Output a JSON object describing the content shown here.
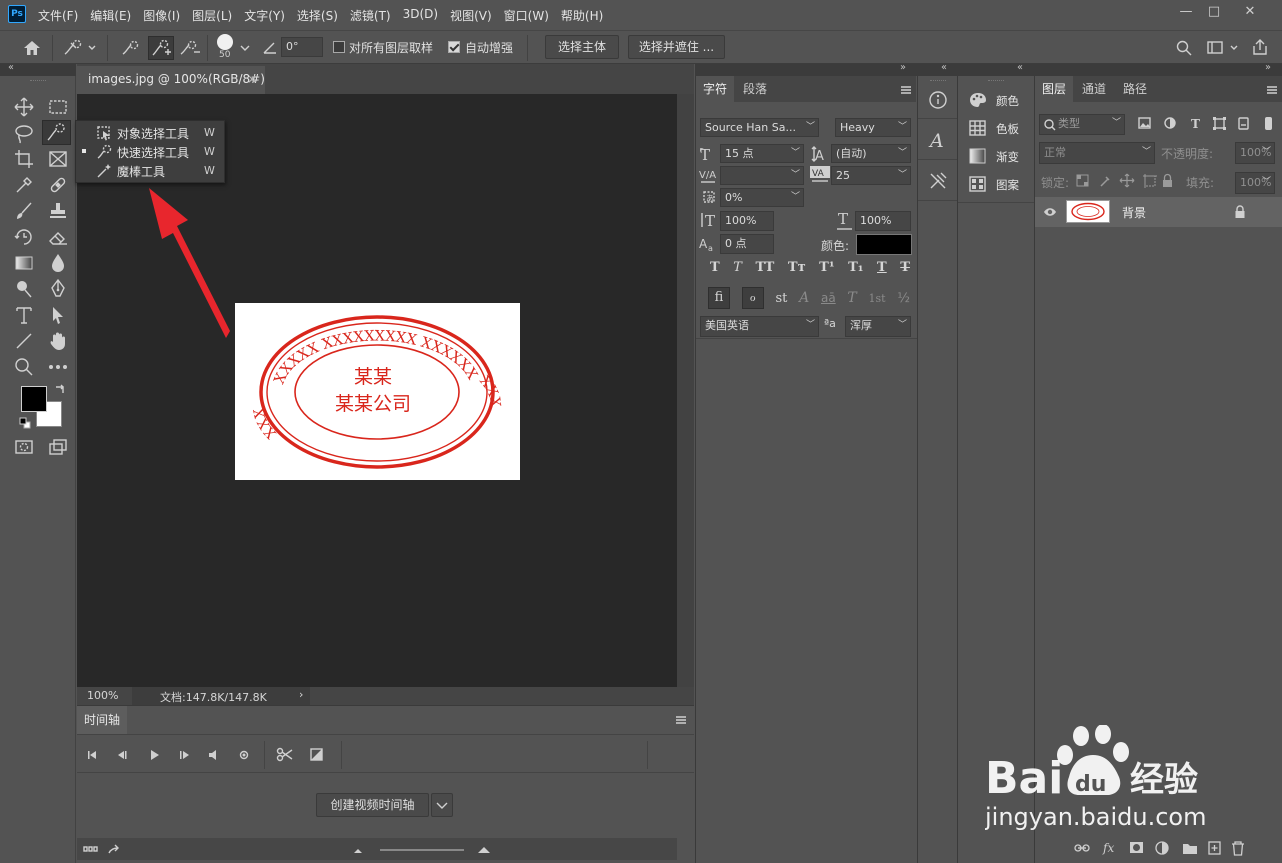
{
  "app": {
    "logo": "Ps"
  },
  "menu": [
    "文件(F)",
    "编辑(E)",
    "图像(I)",
    "图层(L)",
    "文字(Y)",
    "选择(S)",
    "滤镜(T)",
    "3D(D)",
    "视图(V)",
    "窗口(W)",
    "帮助(H)"
  ],
  "window_controls": {
    "minimize": "—",
    "restore": "□",
    "close": "✕"
  },
  "options": {
    "brush_size": "50",
    "angle": "0°",
    "sample_all_label": "对所有图层取样",
    "sample_all_checked": false,
    "auto_enhance_label": "自动增强",
    "auto_enhance_checked": true,
    "select_subject": "选择主体",
    "select_mask": "选择并遮住 ..."
  },
  "document": {
    "tab_title": "images.jpg @ 100%(RGB/8#)",
    "tab_close": "×",
    "zoom": "100%",
    "doc_info": "文档:147.8K/147.8K",
    "status_arrow": "›",
    "stamp_top_text": "XXXXX XXXXXXXXX XXXXXX",
    "stamp_left_text": "XXX",
    "stamp_right_text": "XXX",
    "stamp_line1": "某某",
    "stamp_line2": "某某公司",
    "stamp_color": "#d9261c"
  },
  "flyout": {
    "items": [
      {
        "label": "对象选择工具",
        "key": "W",
        "active": false
      },
      {
        "label": "快速选择工具",
        "key": "W",
        "active": true
      },
      {
        "label": "魔棒工具",
        "key": "W",
        "active": false
      }
    ]
  },
  "annotation": {
    "arrow_color": "#e8262d"
  },
  "timeline": {
    "tab": "时间轴",
    "create_button": "创建视频时间轴"
  },
  "character": {
    "tab_char": "字符",
    "tab_para": "段落",
    "font_family": "Source Han Sa...",
    "font_style": "Heavy",
    "font_size": "15 点",
    "leading": "(自动)",
    "kerning": "",
    "tracking": "25",
    "tsume": "0%",
    "vscale": "100%",
    "hscale": "100%",
    "baseline": "0 点",
    "color_label": "颜色:",
    "color_value": "#000000",
    "language": "美国英语",
    "aa_label": "ªa",
    "aa_method": "浑厚",
    "style_buttons": [
      "T",
      "T",
      "TT",
      "Tт",
      "T¹",
      "T₁",
      "T",
      "T"
    ],
    "ot_buttons": [
      "fi",
      "ℴ",
      "st",
      "A",
      "aā",
      "T",
      "1st",
      "½"
    ]
  },
  "colorpanel": {
    "items": [
      "颜色",
      "色板",
      "渐变",
      "图案"
    ]
  },
  "layers": {
    "tab_layers": "图层",
    "tab_channels": "通道",
    "tab_paths": "路径",
    "filter_type": "类型",
    "blend_mode": "正常",
    "opacity_label": "不透明度:",
    "opacity_value": "100%",
    "lock_label": "锁定:",
    "fill_label": "填充:",
    "fill_value": "100%",
    "layer_name": "背景",
    "footer_icons": [
      "link-icon",
      "fx-icon",
      "mask-icon",
      "adjustment-icon",
      "group-icon",
      "new-layer-icon",
      "trash-icon"
    ],
    "fx_label": "fx"
  },
  "watermark": {
    "brand": "Bai",
    "du": "du",
    "cn": "经验",
    "url": "jingyan.baidu.com"
  }
}
